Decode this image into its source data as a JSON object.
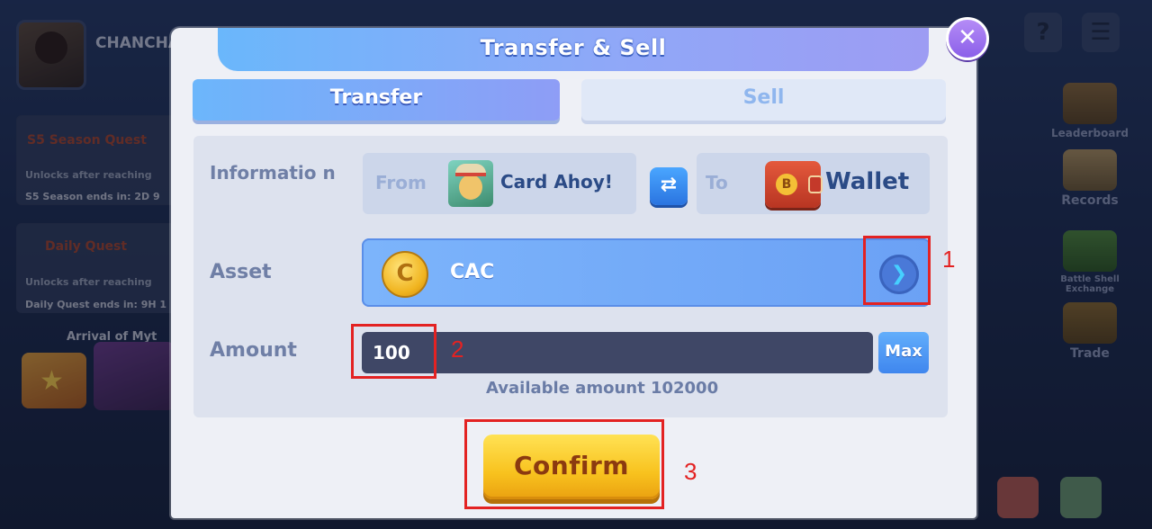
{
  "background": {
    "player_name": "CHANCHA",
    "season_quest_title": "S5 Season Quest",
    "season_quest_unlock": "Unlocks after reaching",
    "season_ends": "S5 Season ends in:  2D 9",
    "daily_quest_title": "Daily Quest",
    "daily_quest_unlock": "Unlocks after reaching",
    "daily_ends": "Daily Quest ends in:  9H 1",
    "arrival_text": "Arrival of Myt",
    "right_menu": [
      {
        "label": "Leaderboard",
        "icon": "trophy-icon"
      },
      {
        "label": "Records",
        "icon": "scroll-icon"
      },
      {
        "label": "Battle Shell Exchange",
        "icon": "treasure-chest-icon"
      },
      {
        "label": "Trade",
        "icon": "scales-icon"
      }
    ],
    "top_help_glyph": "?",
    "top_menu_glyph": "☰"
  },
  "modal": {
    "title": "Transfer & Sell",
    "close_glyph": "✕",
    "tabs": [
      {
        "label": "Transfer",
        "active": true
      },
      {
        "label": "Sell",
        "active": false
      }
    ],
    "information_label": "Informatio n",
    "from_prefix": "From",
    "from_name": "Card Ahoy!",
    "to_prefix": "To",
    "to_name": "Wallet",
    "swap_glyph": "⇄",
    "asset_label": "Asset",
    "asset_name": "CAC",
    "coin_glyph": "C",
    "wallet_coin_glyph": "B",
    "asset_arrow_glyph": "❯",
    "amount_label": "Amount",
    "amount_value": "100",
    "max_label": "Max",
    "available_text": "Available amount 102000",
    "confirm_label": "Confirm"
  },
  "annotations": [
    {
      "number": "1",
      "target": "asset-select-arrow"
    },
    {
      "number": "2",
      "target": "amount-input"
    },
    {
      "number": "3",
      "target": "confirm-button"
    }
  ],
  "colors": {
    "accent_blue": "#6ab7fb",
    "confirm_yellow": "#f8c21e",
    "annotation_red": "#e32222",
    "modal_bg": "#eef0f6"
  }
}
